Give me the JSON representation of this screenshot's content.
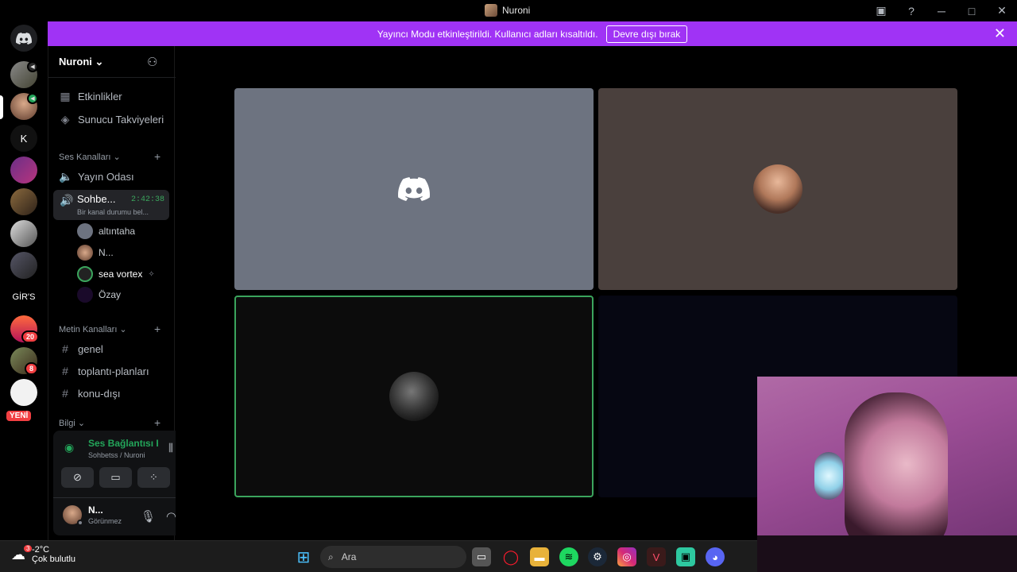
{
  "window": {
    "title": "Nuroni"
  },
  "banner": {
    "text": "Yayıncı Modu etkinleştirildi. Kullanıcı adları kısaltıldı.",
    "button": "Devre dışı bırak"
  },
  "rail": {
    "dm_label": "K",
    "girs_label": "GİR'S",
    "new_label": "YENİ",
    "badge_20": "20",
    "badge_8": "8"
  },
  "sidebar": {
    "server_name": "Nuroni",
    "events": "Etkinlikler",
    "boosts": "Sunucu Takviyeleri",
    "voice_category": "Ses Kanalları",
    "voice_channels": [
      {
        "label": "Yayın Odası"
      },
      {
        "label": "Sohbe...",
        "time": "2:42:38",
        "status": "Bir kanal durumu bel..."
      }
    ],
    "voice_users": [
      {
        "name": "altıntaha"
      },
      {
        "name": "N..."
      },
      {
        "name": "sea vortex"
      },
      {
        "name": "Özay"
      }
    ],
    "text_category": "Metin Kanalları",
    "text_channels": [
      {
        "label": "genel"
      },
      {
        "label": "toplantı-planları"
      },
      {
        "label": "konu-dışı"
      }
    ],
    "info_category": "Bilgi"
  },
  "voice_panel": {
    "status": "Ses Bağlantısı Kuruldu",
    "sub": "Sohbetss / Nuroni"
  },
  "user_panel": {
    "name": "N...",
    "status": "Görünmez"
  },
  "taskbar": {
    "temp": "-2°C",
    "condition": "Çok bulutlu",
    "search": "Ara",
    "weather_badge": "3"
  },
  "colors": {
    "accent": "#a033f5",
    "connected": "#23a55a",
    "speaking_border": "#3ba55d"
  }
}
